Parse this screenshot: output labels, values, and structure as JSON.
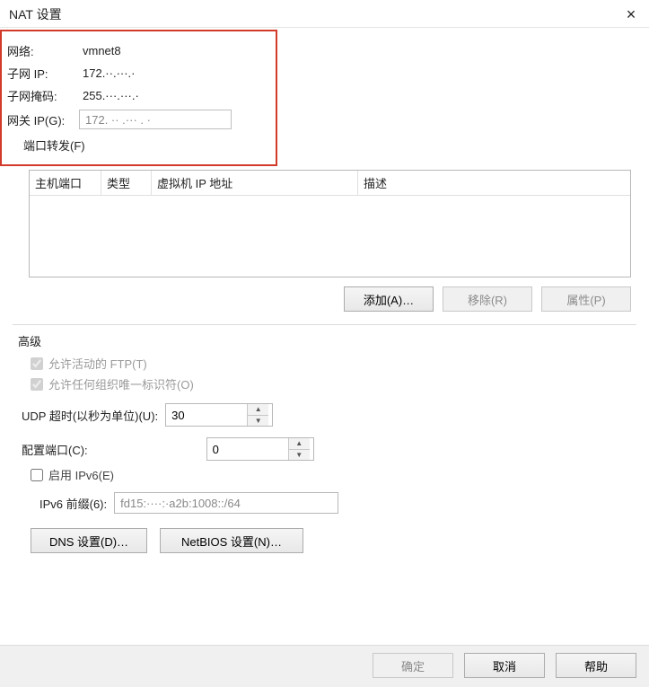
{
  "title": "NAT 设置",
  "network": {
    "label_network": "网络:",
    "value_network": "vmnet8",
    "label_subnet_ip": "子网 IP:",
    "value_subnet_ip": "172.··.···.·",
    "label_subnet_mask": "子网掩码:",
    "value_subnet_mask": "255.···.···.·",
    "label_gateway": "网关 IP(G):",
    "value_gateway": "172. ·· .··· . ·"
  },
  "port_forward": {
    "heading": "端口转发(F)",
    "cols": {
      "host_port": "主机端口",
      "type": "类型",
      "vm_ip": "虚拟机 IP 地址",
      "desc": "描述"
    },
    "btn_add": "添加(A)…",
    "btn_remove": "移除(R)",
    "btn_props": "属性(P)"
  },
  "advanced": {
    "heading": "高级",
    "allow_active_ftp": "允许活动的 FTP(T)",
    "allow_any_oui": "允许任何组织唯一标识符(O)",
    "udp_timeout_label": "UDP 超时(以秒为单位)(U):",
    "udp_timeout_value": "30",
    "config_port_label": "配置端口(C):",
    "config_port_value": "0",
    "enable_ipv6": "启用 IPv6(E)",
    "ipv6_prefix_label": "IPv6 前缀(6):",
    "ipv6_prefix_value": "fd15:····:·a2b:1008::/64",
    "btn_dns": "DNS 设置(D)…",
    "btn_netbios": "NetBIOS 设置(N)…"
  },
  "footer": {
    "ok": "确定",
    "cancel": "取消",
    "help": "帮助"
  }
}
